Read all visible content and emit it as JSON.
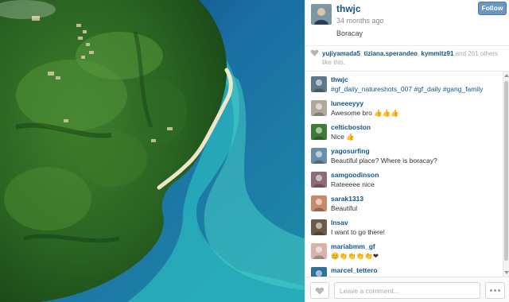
{
  "post": {
    "username": "thwjc",
    "time_ago": "34 months ago",
    "location": "Boracay",
    "follow_label": "Follow",
    "photo_alt": "Aerial view of Boracay coastline"
  },
  "likes": {
    "likers": [
      "yujiyamada5",
      "tiziana.sperandeo",
      "kymmitz91"
    ],
    "suffix": "and 261 others like this."
  },
  "comments": [
    {
      "user": "thwjc",
      "text": "#gf_daily_natureshots_007 #gf_daily #gang_family",
      "is_tags": true,
      "avatar_color": "#5a7a8c"
    },
    {
      "user": "luneeeyyy",
      "text": "Awesome bro 👍👍👍",
      "is_tags": false,
      "avatar_color": "#b0a89a"
    },
    {
      "user": "celticboston",
      "text": "Nice 👍",
      "is_tags": false,
      "avatar_color": "#3f7a3a"
    },
    {
      "user": "yagosurfing",
      "text": "Beautiful place? Where is boracay?",
      "is_tags": false,
      "avatar_color": "#6a8fa8"
    },
    {
      "user": "samgoodinson",
      "text": "Rateeeee nice",
      "is_tags": false,
      "avatar_color": "#8d6b7a"
    },
    {
      "user": "sarak1313",
      "text": "Beautiful",
      "is_tags": false,
      "avatar_color": "#c78a6a"
    },
    {
      "user": "lnsav",
      "text": "I want to go there!",
      "is_tags": false,
      "avatar_color": "#6e5a48"
    },
    {
      "user": "mariabmm_gf",
      "text": "😊👏👏👏👏❤",
      "is_tags": false,
      "avatar_color": "#d9b3a8"
    },
    {
      "user": "marcel_tettero",
      "text": "",
      "is_tags": false,
      "avatar_color": "#2f6f9a"
    }
  ],
  "footer": {
    "comment_placeholder": "Leave a comment..."
  },
  "colors": {
    "link": "#125688",
    "follow_bg": "#6d96bd"
  },
  "icons": [
    "heart-icon",
    "like-heart-icon",
    "more-options-icon"
  ]
}
